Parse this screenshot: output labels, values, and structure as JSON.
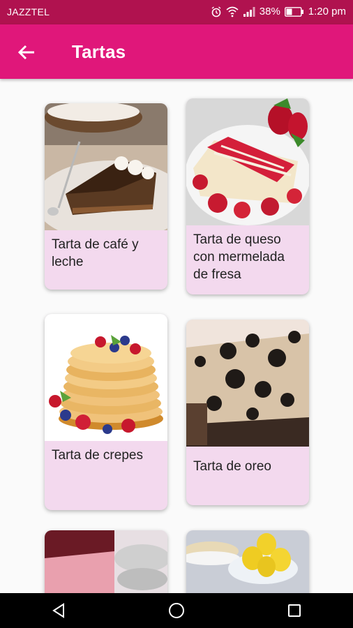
{
  "status_bar": {
    "carrier": "JAZZTEL",
    "battery": "38%",
    "time": "1:20 pm"
  },
  "app_bar": {
    "title": "Tartas",
    "back_icon": "arrow-back-icon"
  },
  "cards": [
    {
      "label": "Tarta de café y leche"
    },
    {
      "label": "Tarta de queso con mermelada de fresa"
    },
    {
      "label": "Tarta de crepes"
    },
    {
      "label": "Tarta de oreo"
    },
    {
      "label": ""
    },
    {
      "label": ""
    }
  ],
  "colors": {
    "status_bar": "#b0124f",
    "app_bar": "#e0177a",
    "card_bg": "#f3d9ee"
  },
  "nav": {
    "back_icon": "triangle-back-icon",
    "home_icon": "circle-home-icon",
    "recents_icon": "square-recents-icon"
  }
}
